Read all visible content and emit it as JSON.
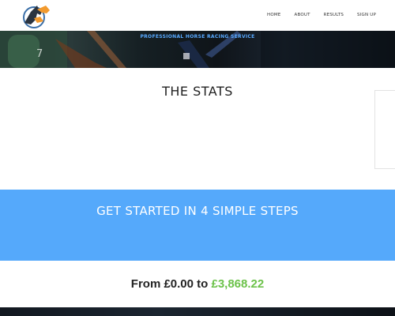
{
  "nav": {
    "items": [
      {
        "label": "HOME"
      },
      {
        "label": "ABOUT"
      },
      {
        "label": "RESULTS"
      },
      {
        "label": "SIGN UP"
      }
    ]
  },
  "hero": {
    "tagline": "PROFESSIONAL HORSE RACING SERVICE"
  },
  "stats": {
    "title": "THE STATS"
  },
  "steps": {
    "title": "GET STARTED IN 4 SIMPLE STEPS"
  },
  "profit": {
    "prefix": "From £0.00 to",
    "amount": "£3,868.22"
  },
  "colors": {
    "accent_blue": "#55a9fb",
    "tagline_blue": "#58a9ff",
    "profit_green": "#6cc24a",
    "logo_orange": "#f29a2e",
    "logo_blue": "#3b6fa8"
  }
}
